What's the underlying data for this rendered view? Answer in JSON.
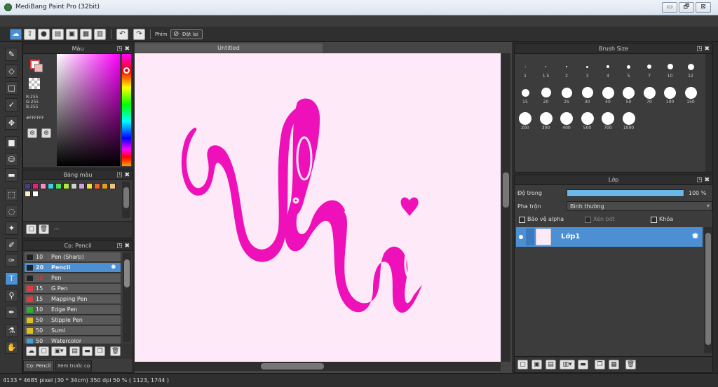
{
  "window": {
    "title": "MediBang Paint Pro (32bit)",
    "controls": [
      "▭",
      "🗗",
      "⊠"
    ]
  },
  "toolbar": {
    "shortcut_label": "Phím",
    "reset_label": "Đặt lại"
  },
  "color_panel": {
    "title": "Màu",
    "r": "R:255",
    "g": "G:255",
    "b": "B:255",
    "hex": "#FFFFFF",
    "fg_color": "#e23a3a",
    "bg_color": "#ffffff"
  },
  "palette_panel": {
    "title": "Bảng màu",
    "swatches": [
      "#4a3a8a",
      "#e8207a",
      "#f090c8",
      "#40d0e0",
      "#50e060",
      "#b0e840",
      "#d0d0d0",
      "#d0a0e0",
      "#f0e040",
      "#f06030",
      "#e0a020",
      "#f8c080",
      "#f8f0c0",
      "#ffffff"
    ],
    "count_label": "---"
  },
  "brush_panel": {
    "title": "Cọ: Pencil",
    "items": [
      {
        "size": "10",
        "name": "Pen (Sharp)",
        "color": "#222222"
      },
      {
        "size": "20",
        "name": "Pencil",
        "color": "#222222"
      },
      {
        "size": "50",
        "name": "Pen",
        "color": "#222222"
      },
      {
        "size": "15",
        "name": "G Pen",
        "color": "#e23a3a"
      },
      {
        "size": "15",
        "name": "Mapping Pen",
        "color": "#e23a3a"
      },
      {
        "size": "10",
        "name": "Edge Pen",
        "color": "#30b030"
      },
      {
        "size": "50",
        "name": "Stipple Pen",
        "color": "#e0c020"
      },
      {
        "size": "50",
        "name": "Sumi",
        "color": "#e0c020"
      },
      {
        "size": "50",
        "name": "Watercolor",
        "color": "#40a0e0"
      }
    ],
    "tabs": [
      "Cọ: Pencil",
      "Xem trước cọ"
    ]
  },
  "canvas": {
    "title": "Untitled",
    "bg": "#fde9f8",
    "ink": "#ee10b8"
  },
  "brush_size_panel": {
    "title": "Brush Size",
    "sizes": [
      "1",
      "1.5",
      "2",
      "3",
      "4",
      "5",
      "7",
      "10",
      "12",
      "15",
      "20",
      "25",
      "30",
      "40",
      "50",
      "70",
      "100",
      "150",
      "200",
      "300",
      "400",
      "500",
      "700",
      "1000"
    ]
  },
  "layer_panel": {
    "title": "Lớp",
    "opacity_label": "Độ trong",
    "opacity_value": 100,
    "opacity_text": "100 %",
    "blend_label": "Pha trộn",
    "blend_value": "Bình thường",
    "protect_alpha": "Bảo vệ alpha",
    "clipping": "Xén bớt",
    "lock": "Khóa",
    "layer_name": "Lớp1"
  },
  "status": {
    "text": "4133 * 4685 pixel  (30 * 34cm)  350 dpi  50 %  ( 1123, 1744 )"
  },
  "colors": {
    "accent": "#4c8fd2",
    "panel": "#3c3c3c"
  }
}
